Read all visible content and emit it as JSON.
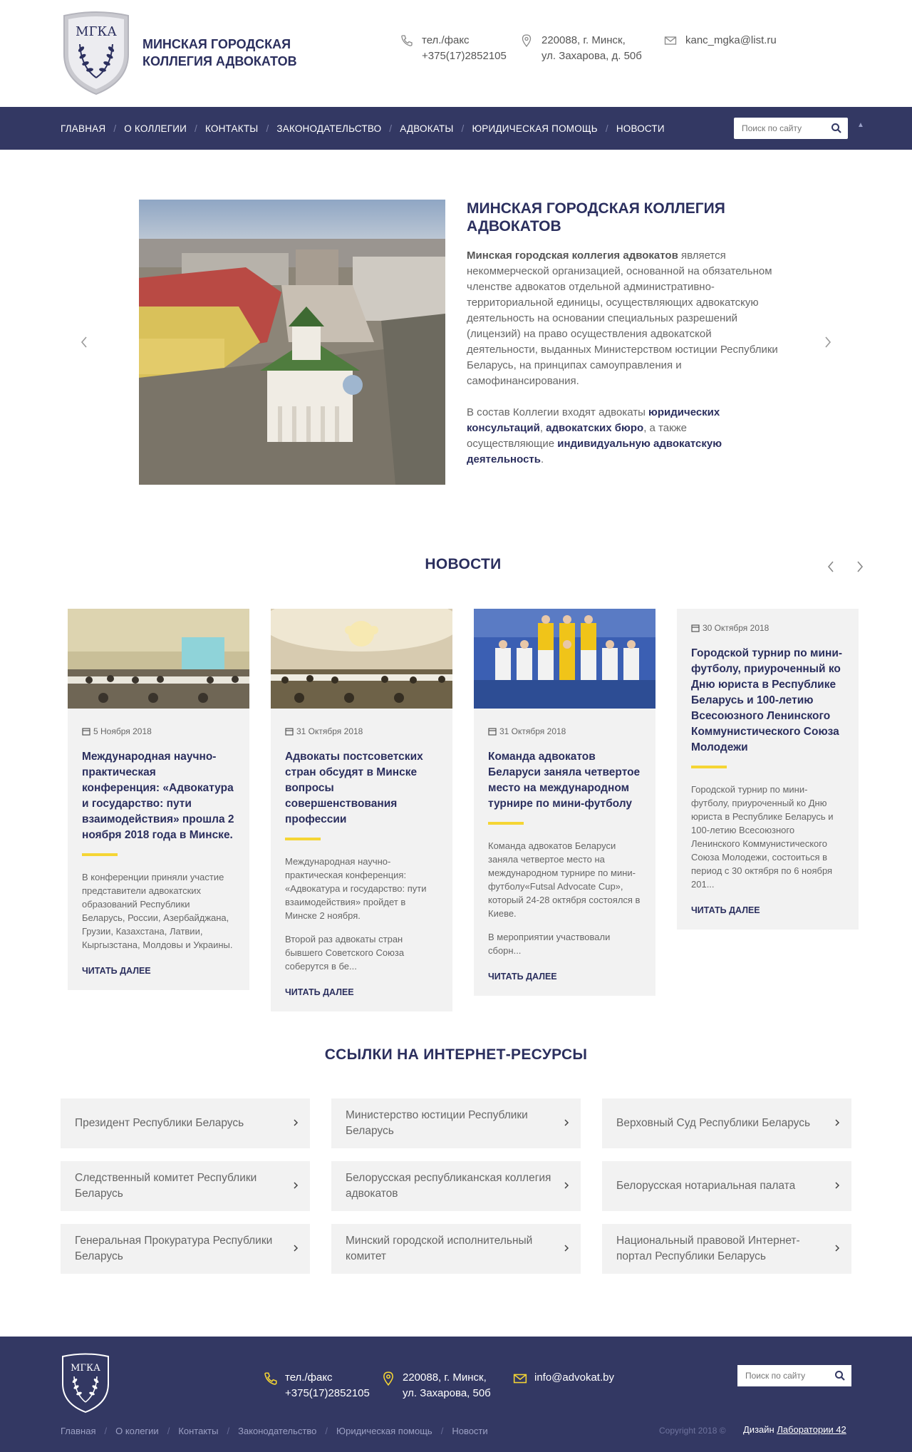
{
  "header": {
    "logo_text": "МГКА",
    "brand_line1": "МИНСКАЯ ГОРОДСКАЯ",
    "brand_line2": "КОЛЛЕГИЯ АДВОКАТОВ",
    "phone_label": "тел./факс",
    "phone": "+375(17)2852105",
    "address_line1": "220088, г. Минск,",
    "address_line2": "ул. Захарова, д. 50б",
    "email": "kanc_mgka@list.ru"
  },
  "nav": {
    "items": [
      "ГЛАВНАЯ",
      "О КОЛЛЕГИИ",
      "КОНТАКТЫ",
      "ЗАКОНОДАТЕЛЬСТВО",
      "АДВОКАТЫ",
      "ЮРИДИЧЕСКАЯ ПОМОЩЬ",
      "НОВОСТИ"
    ],
    "search_placeholder": "Поиск по сайту"
  },
  "hero": {
    "title": "МИНСКАЯ ГОРОДСКАЯ КОЛЛЕГИЯ АДВОКАТОВ",
    "text_bold": "Минская городская коллегия адвокатов",
    "text_rest": " является некоммерческой организацией, основанной на обязательном членстве адвокатов отдельной административно-территориальной единицы, осуществляющих адвокатскую деятельность на основании специальных разрешений (лицензий) на право осуществления адвокатской деятельности, выданных Министерством юстиции Республики Беларусь, на принципах самоуправления и самофинансирования.",
    "p2_a": "В состав Коллегии входят адвокаты ",
    "p2_link1": "юридических консультаций",
    "p2_b": ", ",
    "p2_link2": "адвокатских бюро",
    "p2_c": ", а также осуществляющие ",
    "p2_link3": "индивидуальную адвокатскую деятельность",
    "p2_d": "."
  },
  "news": {
    "title": "НОВОСТИ",
    "more_label": "ЧИТАТЬ ДАЛЕЕ",
    "cards": [
      {
        "date": "5 Ноября 2018",
        "title": "Международная научно-практическая конференция: «Адвокатура и государство: пути взаимодействия» прошла 2 ноября 2018 года в Минске.",
        "p1": "В конференции приняли участие представители адвокатских образований Республики Беларусь, России, Азербайджана, Грузии, Казахстана, Латвии, Кыргызстана, Молдовы и Украины.",
        "p2": ""
      },
      {
        "date": "31 Октября 2018",
        "title": "Адвокаты постсоветских стран обсудят в Минске вопросы совершенствования профессии",
        "p1": "Международная научно-практическая конференция: «Адвокатура и государство: пути взаимодействия» пройдет в Минске 2 ноября.",
        "p2": "Второй раз адвокаты стран бывшего Советского Союза соберутся в бе..."
      },
      {
        "date": "31 Октября 2018",
        "title": "Команда адвокатов Беларуси заняла четвертое место на международном турнире по мини-футболу",
        "p1": "Команда адвокатов Беларуси заняла четвертое место на международном турнире по мини-футболу«Futsal Advocate Cup», который 24-28 октября состоялся в Киеве.",
        "p2": "В мероприятии участвовали сборн..."
      },
      {
        "date": "30 Октября 2018",
        "title": "Городской турнир по мини-футболу, приуроченный ко Дню юриста в Республике Беларусь и 100-летию Всесоюзного Ленинского Коммунистического Союза Молодежи",
        "p1": "Городской турнир по мини-футболу, приуроченный ко Дню юриста в Республике Беларусь и 100-летию Всесоюзного Ленинского Коммунистического Союза Молодежи, состоиться в период с 30 октября по 6 ноября 201...",
        "p2": ""
      }
    ]
  },
  "links": {
    "title": "ССЫЛКИ НА ИНТЕРНЕТ-РЕСУРСЫ",
    "items": [
      "Президент Республики Беларусь",
      "Министерство юстиции Республики Беларусь",
      "Верховный Суд Республики Беларусь",
      "Следственный комитет Республики Беларусь",
      "Белорусская республиканская коллегия адвокатов",
      "Белорусская нотариальная палата",
      "Генеральная Прокуратура Республики Беларусь",
      "Минский городской исполнительный комитет",
      "Национальный правовой Интернет-портал Республики Беларусь"
    ]
  },
  "footer": {
    "logo_text": "МГКА",
    "phone_label": "тел./факс",
    "phone": "+375(17)2852105",
    "address_line1": "220088, г. Минск,",
    "address_line2": "ул. Захарова, 50б",
    "email": "info@advokat.by",
    "search_placeholder": "Поиск по сайту",
    "nav": [
      "Главная",
      "О колегии",
      "Контакты",
      "Законодательство",
      "Юридическая помощь",
      "Новости"
    ],
    "copyright": "Copyright 2018 ©",
    "design_label": "Дизайн ",
    "design_link": "Лаборатории 42"
  },
  "colors": {
    "primary": "#333863",
    "accent": "#f5d534",
    "card_bg": "#f2f2f2"
  }
}
